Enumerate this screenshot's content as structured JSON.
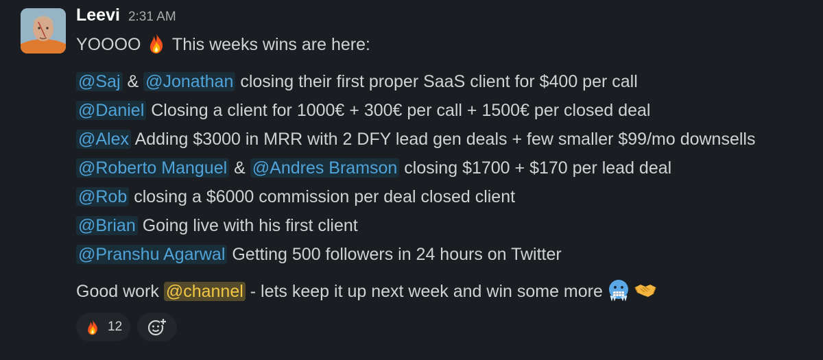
{
  "message": {
    "sender": "Leevi",
    "timestamp": "2:31 AM",
    "intro_before": "YOOOO",
    "intro_emoji": "fire-emoji",
    "intro_after": "This weeks wins are here:",
    "wins": [
      {
        "mentions": [
          "@Saj",
          "@Jonathan"
        ],
        "joiner": "&",
        "text": "closing their first proper SaaS client for $400 per call"
      },
      {
        "mentions": [
          "@Daniel"
        ],
        "text": "Closing a client for 1000€ + 300€ per call + 1500€ per closed deal"
      },
      {
        "mentions": [
          "@Alex"
        ],
        "text": "Adding $3000 in MRR with 2 DFY lead gen deals + few smaller $99/mo downsells"
      },
      {
        "mentions": [
          "@Roberto Manguel",
          "@Andres Bramson"
        ],
        "joiner": "&",
        "text": "closing $1700 + $170 per lead deal"
      },
      {
        "mentions": [
          "@Rob"
        ],
        "text": "closing a $6000 commission per deal closed client"
      },
      {
        "mentions": [
          "@Brian"
        ],
        "text": "Going live with his first client"
      },
      {
        "mentions": [
          "@Pranshu Agarwal"
        ],
        "text": "Getting 500 followers in 24 hours on Twitter"
      }
    ],
    "outro_before": "Good work",
    "outro_mention": "@channel",
    "outro_after": "- lets keep it up next week and win some more",
    "outro_emojis": [
      "cold-face-emoji",
      "handshake-emoji"
    ]
  },
  "reactions": [
    {
      "emoji": "fire-emoji",
      "count": "12"
    }
  ],
  "add_reaction_icon": "add-reaction-icon",
  "colors": {
    "background": "#1a1d21",
    "mention": "#4fa3d8",
    "channel_mention": "#f2c744"
  }
}
